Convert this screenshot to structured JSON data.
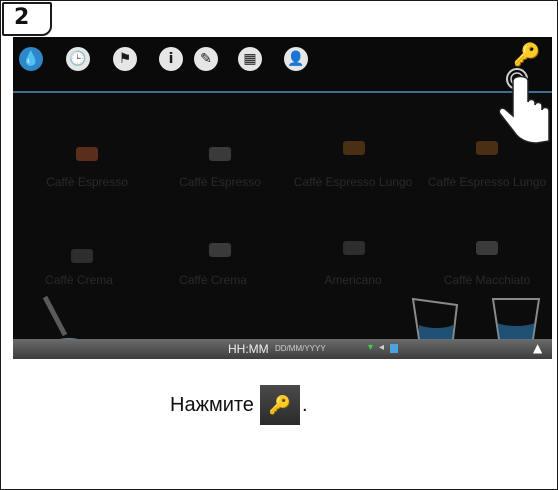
{
  "step": {
    "number": "2"
  },
  "toolbar": {
    "icons": [
      {
        "name": "water-drop-icon",
        "glyph": "💧"
      },
      {
        "name": "clock-icon",
        "glyph": "🕒"
      },
      {
        "name": "flag-icon",
        "glyph": "⚑"
      },
      {
        "name": "info-icon",
        "glyph": "i"
      },
      {
        "name": "pencil-icon",
        "glyph": "✎"
      },
      {
        "name": "calculator-icon",
        "glyph": "▦"
      },
      {
        "name": "user-icon",
        "glyph": "👤"
      }
    ],
    "key_glyph": "🔑"
  },
  "drinks": [
    {
      "label": "Caffè Espresso"
    },
    {
      "label": "Caffè Espresso"
    },
    {
      "label": "Caffè Espresso Lungo"
    },
    {
      "label": "Caffè Espresso Lungo"
    },
    {
      "label": "Caffè Crema"
    },
    {
      "label": "Caffè Crema"
    },
    {
      "label": "Americano"
    },
    {
      "label": "Caffè Macchiato"
    }
  ],
  "status": {
    "time": "HH:MM",
    "date": "DD/MM/YYYY"
  },
  "instruction": {
    "text": "Нажмите",
    "punctuation": "."
  },
  "colors": {
    "accent": "#2f86c8",
    "topbar_line": "#3d6f95",
    "screen_bg": "#0c0c0c"
  }
}
